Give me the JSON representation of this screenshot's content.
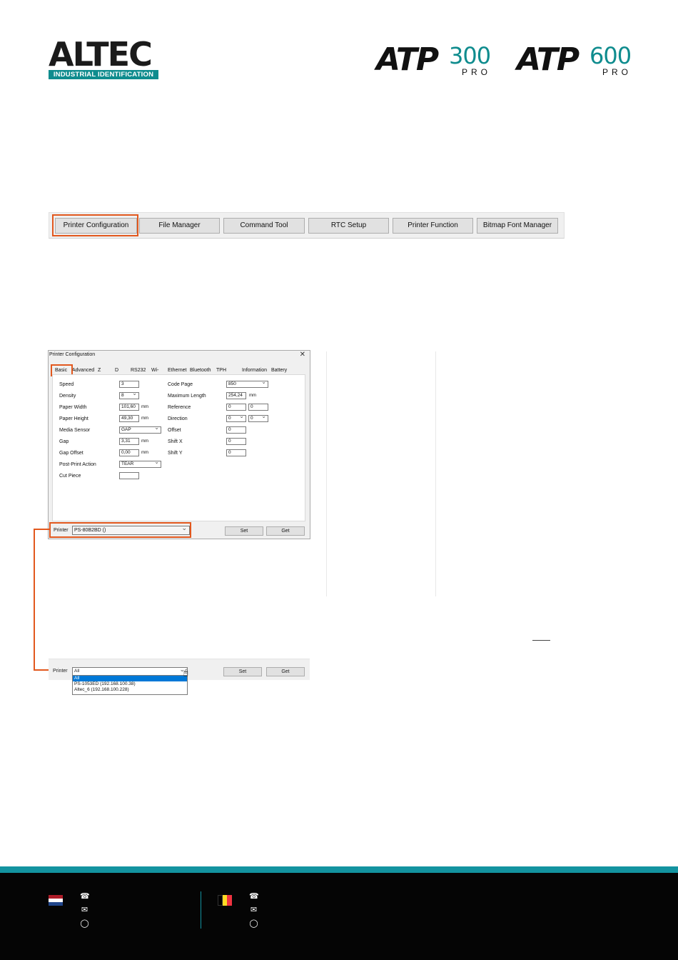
{
  "header": {
    "logo_word": "ALTEC",
    "logo_tagline": "INDUSTRIAL IDENTIFICATION",
    "models": [
      {
        "prefix": "ATP",
        "number": "300",
        "suffix": "PRO"
      },
      {
        "prefix": "ATP",
        "number": "600",
        "suffix": "PRO"
      }
    ]
  },
  "toolbar": {
    "buttons": [
      "Printer Configuration",
      "File Manager",
      "Command Tool",
      "RTC Setup",
      "Printer Function",
      "Bitmap Font Manager"
    ]
  },
  "dialog": {
    "title": "Printer Configuration",
    "close": "✕",
    "tabs": [
      "Basic",
      "Advanced",
      "Z",
      "D",
      "RS232",
      "Wi-Fi",
      "Ethernet",
      "Bluetooth",
      "TPH Care",
      "Information",
      "Battery"
    ],
    "left_fields": [
      {
        "label": "Speed",
        "value": "3",
        "unit": ""
      },
      {
        "label": "Density",
        "value": "8",
        "unit": ""
      },
      {
        "label": "Paper Width",
        "value": "101,60",
        "unit": "mm"
      },
      {
        "label": "Paper Height",
        "value": "49,30",
        "unit": "mm"
      },
      {
        "label": "Media Sensor",
        "value": "GAP",
        "unit": ""
      },
      {
        "label": "Gap",
        "value": "3,31",
        "unit": "mm"
      },
      {
        "label": "Gap Offset",
        "value": "0,00",
        "unit": "mm"
      },
      {
        "label": "Post-Print Action",
        "value": "TEAR",
        "unit": ""
      },
      {
        "label": "Cut Piece",
        "value": "",
        "unit": ""
      }
    ],
    "right_fields": [
      {
        "label": "Code Page",
        "value": "850",
        "value2": "",
        "unit": ""
      },
      {
        "label": "Maximum Length",
        "value": "254,24",
        "value2": "",
        "unit": "mm"
      },
      {
        "label": "Reference",
        "value": "0",
        "value2": "0",
        "unit": ""
      },
      {
        "label": "Direction",
        "value": "0",
        "value2": "0",
        "unit": ""
      },
      {
        "label": "Offset",
        "value": "0",
        "value2": "",
        "unit": ""
      },
      {
        "label": "Shift X",
        "value": "0",
        "value2": "",
        "unit": ""
      },
      {
        "label": "Shift Y",
        "value": "0",
        "value2": "",
        "unit": ""
      }
    ],
    "printer_label": "Printer",
    "printer_value": "PS-80B2BD ()",
    "set_label": "Set",
    "get_label": "Get"
  },
  "printer_selector": {
    "label": "Printer",
    "value": "All",
    "set_label": "Set",
    "get_label": "Get",
    "options": [
      "All",
      "PS-1053ED (192.168.100.38)",
      "Altec_6 (192.168.100.228)"
    ]
  },
  "colors": {
    "accent": "#e2581e",
    "brand_teal": "#1393a0",
    "footer_bg": "#050505"
  },
  "footer": {
    "icons": [
      "phone-icon",
      "mail-icon",
      "globe-icon"
    ]
  }
}
